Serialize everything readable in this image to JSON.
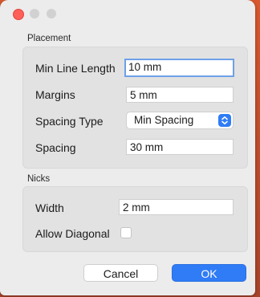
{
  "window": {
    "traffic_lights": [
      "close",
      "minimize",
      "zoom"
    ]
  },
  "placement": {
    "section_label": "Placement",
    "min_line_length": {
      "label": "Min Line Length",
      "value": "10 mm"
    },
    "margins": {
      "label": "Margins",
      "value": "5 mm"
    },
    "spacing_type": {
      "label": "Spacing Type",
      "value": "Min Spacing"
    },
    "spacing": {
      "label": "Spacing",
      "value": "30 mm"
    }
  },
  "nicks": {
    "section_label": "Nicks",
    "width": {
      "label": "Width",
      "value": "2 mm"
    },
    "allow_diagonal": {
      "label": "Allow Diagonal",
      "checked": false
    }
  },
  "buttons": {
    "cancel": "Cancel",
    "ok": "OK"
  },
  "colors": {
    "accent": "#2f7cf6",
    "close_button": "#ff5f57",
    "dialog_bg": "#ececec",
    "group_bg": "#e2e2e2"
  }
}
